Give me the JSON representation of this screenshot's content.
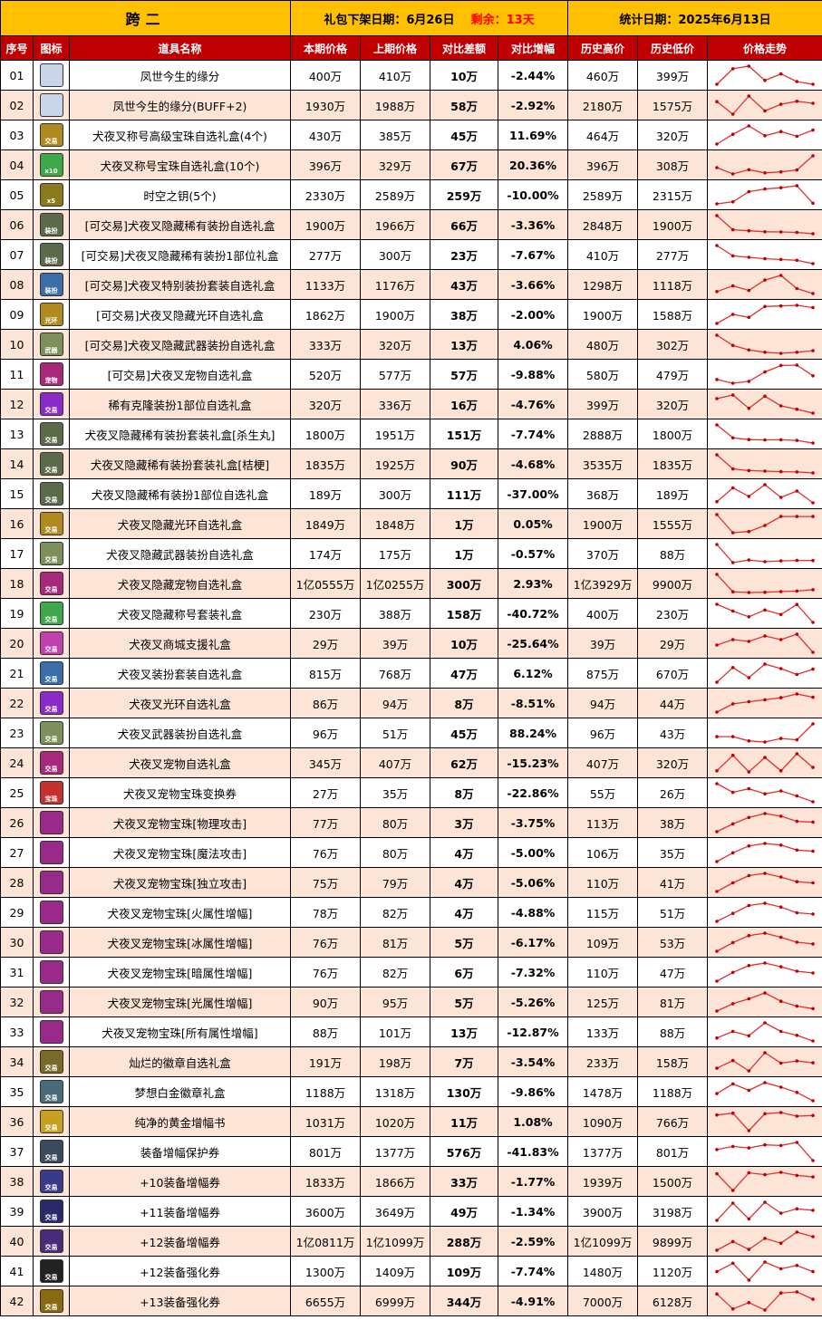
{
  "header": {
    "region": "跨二",
    "deadline_label": "礼包下架日期：",
    "deadline_value": "6月26日",
    "remaining_label": "剩余：",
    "remaining_value": "13天",
    "stat_label": "统计日期：",
    "stat_value": "2025年6月13日"
  },
  "columns": [
    "序号",
    "图标",
    "道具名称",
    "本期价格",
    "上期价格",
    "对比差额",
    "对比增幅",
    "历史高价",
    "历史低价",
    "价格走势"
  ],
  "rows": [
    {
      "no": "01",
      "name": "凤世今生的缘分",
      "cur": "400万",
      "prev": "410万",
      "diff": "10万",
      "pct": "-2.44%",
      "high": "460万",
      "low": "399万",
      "icon": "gift-white-icon",
      "icon_text": "",
      "trend": [
        400,
        520,
        540,
        430,
        480,
        420,
        400
      ]
    },
    {
      "no": "02",
      "name": "凤世今生的缘分(BUFF+2)",
      "cur": "1930万",
      "prev": "1988万",
      "diff": "58万",
      "pct": "-2.92%",
      "high": "2180万",
      "low": "1575万",
      "icon": "gift-white-icon",
      "icon_text": "",
      "trend": [
        1980,
        1600,
        2150,
        1700,
        1900,
        1990,
        1930
      ]
    },
    {
      "no": "03",
      "name": "犬夜叉称号高级宝珠自选礼盒(4个)",
      "cur": "430万",
      "prev": "385万",
      "diff": "45万",
      "pct": "11.69%",
      "high": "464万",
      "low": "320万",
      "icon": "gold-box-icon",
      "icon_text": "交易",
      "trend": [
        330,
        400,
        460,
        390,
        420,
        385,
        430
      ]
    },
    {
      "no": "04",
      "name": "犬夜叉称号宝珠自选礼盒(10个)",
      "cur": "396万",
      "prev": "329万",
      "diff": "67万",
      "pct": "20.36%",
      "high": "396万",
      "low": "308万",
      "icon": "green-orb-icon",
      "icon_text": "x10",
      "trend": [
        340,
        310,
        330,
        315,
        320,
        329,
        396
      ]
    },
    {
      "no": "05",
      "name": "时空之钥(5个)",
      "cur": "2330万",
      "prev": "2589万",
      "diff": "259万",
      "pct": "-10.00%",
      "high": "2589万",
      "low": "2315万",
      "icon": "key-icon",
      "icon_text": "x5",
      "trend": [
        2320,
        2350,
        2500,
        2540,
        2560,
        2589,
        2330
      ]
    },
    {
      "no": "06",
      "name": "[可交易]犬夜叉隐藏稀有装扮自选礼盒",
      "cur": "1900万",
      "prev": "1966万",
      "diff": "66万",
      "pct": "-3.36%",
      "high": "2848万",
      "low": "1900万",
      "icon": "costume-box-icon",
      "icon_text": "装扮",
      "trend": [
        2800,
        2100,
        2050,
        2000,
        1990,
        1966,
        1900
      ]
    },
    {
      "no": "07",
      "name": "[可交易]犬夜叉隐藏稀有装扮1部位礼盒",
      "cur": "277万",
      "prev": "300万",
      "diff": "23万",
      "pct": "-7.67%",
      "high": "410万",
      "low": "277万",
      "icon": "costume-box-icon",
      "icon_text": "装扮",
      "trend": [
        400,
        330,
        320,
        310,
        305,
        300,
        277
      ]
    },
    {
      "no": "08",
      "name": "[可交易]犬夜叉特别装扮套装自选礼盒",
      "cur": "1133万",
      "prev": "1176万",
      "diff": "43万",
      "pct": "-3.66%",
      "high": "1298万",
      "low": "1118万",
      "icon": "blue-box-icon",
      "icon_text": "装扮",
      "trend": [
        1150,
        1200,
        1160,
        1250,
        1290,
        1176,
        1133
      ]
    },
    {
      "no": "09",
      "name": "[可交易]犬夜叉隐藏光环自选礼盒",
      "cur": "1862万",
      "prev": "1900万",
      "diff": "38万",
      "pct": "-2.00%",
      "high": "1900万",
      "low": "1588万",
      "icon": "gold-box-icon",
      "icon_text": "光环",
      "trend": [
        1600,
        1750,
        1700,
        1880,
        1890,
        1900,
        1862
      ]
    },
    {
      "no": "10",
      "name": "[可交易]犬夜叉隐藏武器装扮自选礼盒",
      "cur": "333万",
      "prev": "320万",
      "diff": "13万",
      "pct": "4.06%",
      "high": "480万",
      "low": "302万",
      "icon": "weapon-box-icon",
      "icon_text": "武器",
      "trend": [
        470,
        380,
        340,
        320,
        310,
        320,
        333
      ]
    },
    {
      "no": "11",
      "name": "[可交易]犬夜叉宠物自选礼盒",
      "cur": "520万",
      "prev": "577万",
      "diff": "57万",
      "pct": "-9.88%",
      "high": "580万",
      "low": "479万",
      "icon": "pet-box-icon",
      "icon_text": "宠物",
      "trend": [
        500,
        480,
        490,
        540,
        575,
        577,
        520
      ]
    },
    {
      "no": "12",
      "name": "稀有克隆装扮1部位自选礼盒",
      "cur": "320万",
      "prev": "336万",
      "diff": "16万",
      "pct": "-4.76%",
      "high": "399万",
      "low": "320万",
      "icon": "purple-orb-icon",
      "icon_text": "交易",
      "trend": [
        380,
        395,
        340,
        390,
        350,
        336,
        320
      ]
    },
    {
      "no": "13",
      "name": "犬夜叉隐藏稀有装扮套装礼盒[杀生丸]",
      "cur": "1800万",
      "prev": "1951万",
      "diff": "151万",
      "pct": "-7.74%",
      "high": "2888万",
      "low": "1800万",
      "icon": "costume-box-icon",
      "icon_text": "交易",
      "trend": [
        2850,
        2100,
        2000,
        1980,
        1990,
        1951,
        1800
      ]
    },
    {
      "no": "14",
      "name": "犬夜叉隐藏稀有装扮套装礼盒[桔梗]",
      "cur": "1835万",
      "prev": "1925万",
      "diff": "90万",
      "pct": "-4.68%",
      "high": "3535万",
      "low": "1835万",
      "icon": "costume-box-icon",
      "icon_text": "交易",
      "trend": [
        3500,
        2200,
        2050,
        2000,
        1950,
        1925,
        1835
      ]
    },
    {
      "no": "15",
      "name": "犬夜叉隐藏稀有装扮1部位自选礼盒",
      "cur": "189万",
      "prev": "300万",
      "diff": "111万",
      "pct": "-37.00%",
      "high": "368万",
      "low": "189万",
      "icon": "costume-box-icon",
      "icon_text": "交易",
      "trend": [
        200,
        330,
        250,
        360,
        240,
        300,
        189
      ]
    },
    {
      "no": "16",
      "name": "犬夜叉隐藏光环自选礼盒",
      "cur": "1849万",
      "prev": "1848万",
      "diff": "1万",
      "pct": "0.05%",
      "high": "1900万",
      "low": "1555万",
      "icon": "gold-box-icon",
      "icon_text": "交易",
      "trend": [
        1880,
        1580,
        1600,
        1700,
        1850,
        1848,
        1849
      ]
    },
    {
      "no": "17",
      "name": "犬夜叉隐藏武器装扮自选礼盒",
      "cur": "174万",
      "prev": "175万",
      "diff": "1万",
      "pct": "-0.57%",
      "high": "370万",
      "low": "88万",
      "icon": "weapon-box-icon",
      "icon_text": "交易",
      "trend": [
        360,
        150,
        180,
        160,
        170,
        175,
        174
      ]
    },
    {
      "no": "18",
      "name": "犬夜叉隐藏宠物自选礼盒",
      "cur": "1亿0555万",
      "prev": "1亿0255万",
      "diff": "300万",
      "pct": "2.93%",
      "high": "1亿3929万",
      "low": "9900万",
      "icon": "pet-box-icon",
      "icon_text": "交易",
      "trend": [
        13800,
        10100,
        9950,
        10000,
        10150,
        10255,
        10555
      ]
    },
    {
      "no": "19",
      "name": "犬夜叉隐藏称号套装礼盒",
      "cur": "230万",
      "prev": "388万",
      "diff": "158万",
      "pct": "-40.72%",
      "high": "400万",
      "low": "230万",
      "icon": "green-orb-icon",
      "icon_text": "交易",
      "trend": [
        390,
        330,
        280,
        340,
        300,
        388,
        230
      ]
    },
    {
      "no": "20",
      "name": "犬夜叉商城支援礼盒",
      "cur": "29万",
      "prev": "39万",
      "diff": "10万",
      "pct": "-25.64%",
      "high": "39万",
      "low": "29万",
      "icon": "pink-box-icon",
      "icon_text": "交易",
      "trend": [
        33,
        36,
        35,
        38,
        36,
        39,
        29
      ]
    },
    {
      "no": "21",
      "name": "犬夜叉装扮套装自选礼盒",
      "cur": "815万",
      "prev": "768万",
      "diff": "47万",
      "pct": "6.12%",
      "high": "875万",
      "low": "670万",
      "icon": "blue-box-icon",
      "icon_text": "交易",
      "trend": [
        700,
        830,
        740,
        860,
        820,
        768,
        815
      ]
    },
    {
      "no": "22",
      "name": "犬夜叉光环自选礼盒",
      "cur": "86万",
      "prev": "94万",
      "diff": "8万",
      "pct": "-8.51%",
      "high": "94万",
      "low": "44万",
      "icon": "purple-orb-icon",
      "icon_text": "交易",
      "trend": [
        50,
        70,
        75,
        80,
        85,
        94,
        86
      ]
    },
    {
      "no": "23",
      "name": "犬夜叉武器装扮自选礼盒",
      "cur": "96万",
      "prev": "51万",
      "diff": "45万",
      "pct": "88.24%",
      "high": "96万",
      "low": "43万",
      "icon": "weapon-box-icon",
      "icon_text": "交易",
      "trend": [
        60,
        60,
        48,
        45,
        55,
        51,
        96
      ]
    },
    {
      "no": "24",
      "name": "犬夜叉宠物自选礼盒",
      "cur": "345万",
      "prev": "407万",
      "diff": "62万",
      "pct": "-15.23%",
      "high": "407万",
      "low": "320万",
      "icon": "pet-box-icon",
      "icon_text": "交易",
      "trend": [
        330,
        400,
        325,
        390,
        330,
        407,
        345
      ]
    },
    {
      "no": "25",
      "name": "犬夜叉宠物宝珠变换券",
      "cur": "27万",
      "prev": "35万",
      "diff": "8万",
      "pct": "-22.86%",
      "high": "55万",
      "low": "26万",
      "icon": "red-ticket-icon",
      "icon_text": "宝珠",
      "trend": [
        52,
        40,
        45,
        38,
        42,
        35,
        27
      ]
    },
    {
      "no": "26",
      "name": "犬夜叉宠物宝珠[物理攻击]",
      "cur": "77万",
      "prev": "80万",
      "diff": "3万",
      "pct": "-3.75%",
      "high": "113万",
      "low": "38万",
      "icon": "pet-orb-icon",
      "icon_text": "",
      "trend": [
        40,
        70,
        95,
        110,
        100,
        80,
        77
      ]
    },
    {
      "no": "27",
      "name": "犬夜叉宠物宝珠[魔法攻击]",
      "cur": "76万",
      "prev": "80万",
      "diff": "4万",
      "pct": "-5.00%",
      "high": "106万",
      "low": "35万",
      "icon": "pet-orb-icon",
      "icon_text": "",
      "trend": [
        38,
        70,
        95,
        104,
        98,
        80,
        76
      ]
    },
    {
      "no": "28",
      "name": "犬夜叉宠物宝珠[独立攻击]",
      "cur": "75万",
      "prev": "79万",
      "diff": "4万",
      "pct": "-5.06%",
      "high": "110万",
      "low": "41万",
      "icon": "pet-orb-icon",
      "icon_text": "",
      "trend": [
        45,
        75,
        100,
        108,
        95,
        79,
        75
      ]
    },
    {
      "no": "29",
      "name": "犬夜叉宠物宝珠[火属性增幅]",
      "cur": "78万",
      "prev": "82万",
      "diff": "4万",
      "pct": "-4.88%",
      "high": "115万",
      "low": "51万",
      "icon": "pet-orb-icon",
      "icon_text": "",
      "trend": [
        55,
        80,
        105,
        112,
        100,
        82,
        78
      ]
    },
    {
      "no": "30",
      "name": "犬夜叉宠物宝珠[冰属性增幅]",
      "cur": "76万",
      "prev": "81万",
      "diff": "5万",
      "pct": "-6.17%",
      "high": "109万",
      "low": "53万",
      "icon": "pet-orb-icon",
      "icon_text": "",
      "trend": [
        55,
        80,
        100,
        107,
        95,
        81,
        76
      ]
    },
    {
      "no": "31",
      "name": "犬夜叉宠物宝珠[暗属性增幅]",
      "cur": "76万",
      "prev": "82万",
      "diff": "6万",
      "pct": "-7.32%",
      "high": "110万",
      "low": "47万",
      "icon": "pet-orb-icon",
      "icon_text": "",
      "trend": [
        50,
        78,
        100,
        108,
        96,
        82,
        76
      ]
    },
    {
      "no": "32",
      "name": "犬夜叉宠物宝珠[光属性增幅]",
      "cur": "90万",
      "prev": "95万",
      "diff": "5万",
      "pct": "-5.26%",
      "high": "125万",
      "low": "81万",
      "icon": "pet-orb-icon",
      "icon_text": "",
      "trend": [
        85,
        100,
        110,
        122,
        105,
        95,
        90
      ]
    },
    {
      "no": "33",
      "name": "犬夜叉宠物宝珠[所有属性增幅]",
      "cur": "88万",
      "prev": "101万",
      "diff": "13万",
      "pct": "-12.87%",
      "high": "133万",
      "low": "88万",
      "icon": "pet-orb-icon",
      "icon_text": "",
      "trend": [
        95,
        110,
        100,
        130,
        110,
        101,
        88
      ]
    },
    {
      "no": "34",
      "name": "灿烂的徽章自选礼盒",
      "cur": "191万",
      "prev": "198万",
      "diff": "7万",
      "pct": "-3.54%",
      "high": "233万",
      "low": "158万",
      "icon": "emblem-icon",
      "icon_text": "交易",
      "trend": [
        170,
        200,
        160,
        230,
        190,
        198,
        191
      ]
    },
    {
      "no": "35",
      "name": "梦想白金徽章礼盒",
      "cur": "1188万",
      "prev": "1318万",
      "diff": "130万",
      "pct": "-9.86%",
      "high": "1478万",
      "low": "1188万",
      "icon": "platinum-icon",
      "icon_text": "交易",
      "trend": [
        1300,
        1450,
        1350,
        1470,
        1400,
        1318,
        1188
      ]
    },
    {
      "no": "36",
      "name": "纯净的黄金增幅书",
      "cur": "1031万",
      "prev": "1020万",
      "diff": "11万",
      "pct": "1.08%",
      "high": "1090万",
      "low": "766万",
      "icon": "gold-book-icon",
      "icon_text": "交易",
      "trend": [
        1040,
        1070,
        780,
        1060,
        1080,
        1020,
        1031
      ]
    },
    {
      "no": "37",
      "name": "装备增幅保护券",
      "cur": "801万",
      "prev": "1377万",
      "diff": "576万",
      "pct": "-41.83%",
      "high": "1377万",
      "low": "801万",
      "icon": "protect-ticket-icon",
      "icon_text": "交易",
      "trend": [
        1150,
        1250,
        1200,
        1300,
        1280,
        1377,
        801
      ]
    },
    {
      "no": "38",
      "name": "+10装备增幅券",
      "cur": "1833万",
      "prev": "1866万",
      "diff": "33万",
      "pct": "-1.77%",
      "high": "1939万",
      "low": "1500万",
      "icon": "ticket-10-icon",
      "icon_text": "交易",
      "trend": [
        1900,
        1550,
        1920,
        1880,
        1930,
        1866,
        1833
      ]
    },
    {
      "no": "39",
      "name": "+11装备增幅券",
      "cur": "3600万",
      "prev": "3649万",
      "diff": "49万",
      "pct": "-1.34%",
      "high": "3900万",
      "low": "3198万",
      "icon": "ticket-11-icon",
      "icon_text": "交易",
      "trend": [
        3250,
        3850,
        3300,
        3880,
        3500,
        3649,
        3600
      ]
    },
    {
      "no": "40",
      "name": "+12装备增幅券",
      "cur": "1亿0811万",
      "prev": "1亿1099万",
      "diff": "288万",
      "pct": "-2.59%",
      "high": "1亿1099万",
      "low": "9899万",
      "icon": "ticket-12-icon",
      "icon_text": "交易",
      "trend": [
        9950,
        10500,
        10000,
        10700,
        10400,
        11099,
        10811
      ]
    },
    {
      "no": "41",
      "name": "+12装备强化券",
      "cur": "1300万",
      "prev": "1409万",
      "diff": "109万",
      "pct": "-7.74%",
      "high": "1480万",
      "low": "1120万",
      "icon": "ticket-12-black-icon",
      "icon_text": "交易",
      "trend": [
        1300,
        1450,
        1150,
        1470,
        1350,
        1409,
        1300
      ]
    },
    {
      "no": "42",
      "name": "+13装备强化券",
      "cur": "6655万",
      "prev": "6999万",
      "diff": "344万",
      "pct": "-4.91%",
      "high": "7000万",
      "low": "6128万",
      "icon": "ticket-13-icon",
      "icon_text": "交易",
      "trend": [
        6900,
        6200,
        6500,
        6150,
        6950,
        6999,
        6655
      ]
    }
  ],
  "colors": {
    "header_yellow": "#ffc000",
    "header_red": "#c00000",
    "row_alt": "#fce4d6",
    "up_red": "#ff0000",
    "down_green": "#00b050"
  },
  "icon_colors": {
    "gift-white-icon": "#c9d6ea",
    "gold-box-icon": "#b08a1e",
    "green-orb-icon": "#3ea84a",
    "key-icon": "#8a7a1c",
    "costume-box-icon": "#5b6b4a",
    "blue-box-icon": "#3a6ea8",
    "weapon-box-icon": "#7d8f5a",
    "pet-box-icon": "#a8287a",
    "purple-orb-icon": "#8a2ac8",
    "pink-box-icon": "#c040b0",
    "red-ticket-icon": "#c83030",
    "pet-orb-icon": "#9a2a8a",
    "emblem-icon": "#7a6a2a",
    "platinum-icon": "#4a6a7a",
    "gold-book-icon": "#c8a020",
    "protect-ticket-icon": "#3a4a5a",
    "ticket-10-icon": "#3a3a8a",
    "ticket-11-icon": "#2a2a6a",
    "ticket-12-icon": "#4a2a7a",
    "ticket-12-black-icon": "#222222",
    "ticket-13-icon": "#8a6a10"
  }
}
